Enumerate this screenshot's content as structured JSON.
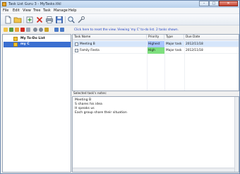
{
  "window": {
    "title": "Task List Guru 3 - MyTasks.tlkl",
    "controls": {
      "minimize": "–",
      "maximize": "□",
      "close": "✕"
    }
  },
  "menu": [
    "File",
    "Edit",
    "View",
    "Tree",
    "Task",
    "Manage",
    "Help"
  ],
  "toolbar": {
    "icons": [
      "new-file-icon",
      "open-folder-icon",
      "add-task-icon",
      "delete-icon",
      "print-icon",
      "save-icon",
      "search-icon",
      "find-icon",
      "tools-icon"
    ]
  },
  "info_bar": {
    "text": "Click here to reset the view. Viewing 'my C' to-do list. 2 tasks shown."
  },
  "tree": {
    "items": [
      {
        "label": "My To-Do List",
        "selected": false
      },
      {
        "label": "my C",
        "selected": true
      }
    ]
  },
  "task_grid": {
    "columns": [
      "Task Name",
      "Priority",
      "Type",
      "Due Date"
    ],
    "rows": [
      {
        "name": "Meeting B",
        "priority": "Highest",
        "type": "Major task",
        "due": "2012/11/18",
        "priority_color": "#a9c6ff",
        "selected": true
      },
      {
        "name": "Family Fiesta",
        "priority": "High",
        "type": "Major task",
        "due": "2012/11/18",
        "priority_color": "#7ee07e",
        "selected": false
      }
    ]
  },
  "notes": {
    "label": "Selected task's notes:",
    "lines": [
      "Meeting B",
      "S shares his idea",
      "H speaks us",
      "Each group share their situation"
    ]
  },
  "colors": {
    "accent": "#3b6fd0",
    "link": "#1a3fc4"
  }
}
